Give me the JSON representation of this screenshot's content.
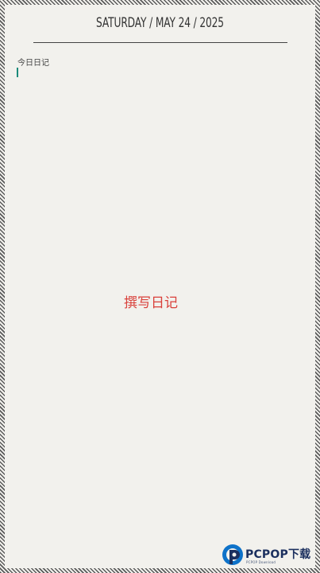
{
  "header": {
    "date": "SATURDAY / MAY 24 / 2025"
  },
  "entry": {
    "label": "今日日记"
  },
  "actions": {
    "write_label": "撰写日记"
  },
  "watermark": {
    "title": "PCPOP下载",
    "subtitle": "PCPOP Download"
  },
  "colors": {
    "background": "#f2f1ed",
    "accent": "#d9403a",
    "cursor": "#1a8a7a"
  }
}
